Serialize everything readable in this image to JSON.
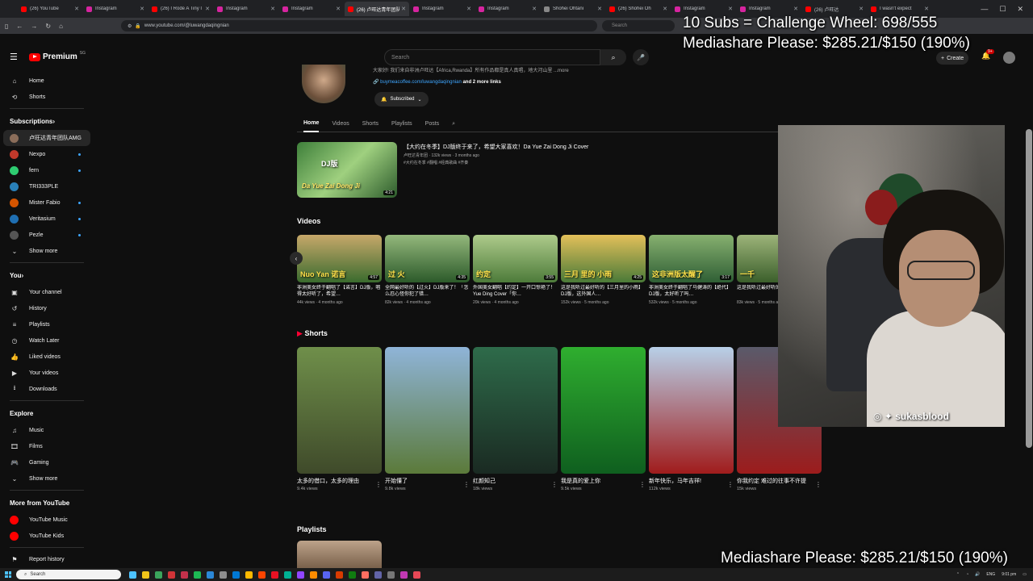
{
  "browser": {
    "tabs": [
      {
        "label": "(26) YouTube",
        "color": "#ff0000",
        "active": false
      },
      {
        "label": "Instagram",
        "color": "#d6249f",
        "active": false
      },
      {
        "label": "(26) I Rode A Tiny I",
        "color": "#ff0000",
        "active": false
      },
      {
        "label": "Instagram",
        "color": "#d6249f",
        "active": false
      },
      {
        "label": "Instagram",
        "color": "#d6249f",
        "active": false
      },
      {
        "label": "(26) 卢旺达青年团队",
        "color": "#ff0000",
        "active": true
      },
      {
        "label": "Instagram",
        "color": "#d6249f",
        "active": false
      },
      {
        "label": "Instagram",
        "color": "#d6249f",
        "active": false
      },
      {
        "label": "Shohei Ohtani",
        "color": "#888888",
        "active": false
      },
      {
        "label": "(26) Shohei Oh",
        "color": "#ff0000",
        "active": false
      },
      {
        "label": "Instagram",
        "color": "#d6249f",
        "active": false
      },
      {
        "label": "Instagram",
        "color": "#d6249f",
        "active": false
      },
      {
        "label": "(26) 卢旺达",
        "color": "#ff0000",
        "active": false
      },
      {
        "label": "I wasn't expect",
        "color": "#ff0000",
        "active": false
      }
    ],
    "url": "www.youtube.com/@luwangdaqingnian",
    "mini_search_placeholder": "Search"
  },
  "youtube": {
    "logo_text": "Premium",
    "logo_country": "SG",
    "search_placeholder": "Search",
    "create_label": "Create",
    "notif_count": "9+"
  },
  "sidebar": {
    "main": [
      {
        "label": "Home",
        "icon": "⌂",
        "name": "home"
      },
      {
        "label": "Shorts",
        "icon": "⟲",
        "name": "shorts"
      }
    ],
    "subscriptions_title": "Subscriptions",
    "subscriptions": [
      {
        "label": "卢旺达青年团队AMG",
        "color": "#8a6d5a",
        "dot": false,
        "active": true
      },
      {
        "label": "Nexpo",
        "color": "#c0392b",
        "dot": true
      },
      {
        "label": "fern",
        "color": "#2ecc71",
        "dot": true
      },
      {
        "label": "TRI333PLE",
        "color": "#2980b9",
        "dot": false
      },
      {
        "label": "Mister Fabio",
        "color": "#d35400",
        "dot": true
      },
      {
        "label": "Veritasium",
        "color": "#1f6fb2",
        "dot": true
      },
      {
        "label": "Pezle",
        "color": "#555555",
        "dot": true
      }
    ],
    "show_more": "Show more",
    "you_title": "You",
    "you": [
      {
        "label": "Your channel",
        "icon": "▣",
        "name": "your-channel"
      },
      {
        "label": "History",
        "icon": "↺",
        "name": "history"
      },
      {
        "label": "Playlists",
        "icon": "≡",
        "name": "playlists"
      },
      {
        "label": "Watch Later",
        "icon": "◷",
        "name": "watch-later"
      },
      {
        "label": "Liked videos",
        "icon": "👍",
        "name": "liked-videos"
      },
      {
        "label": "Your videos",
        "icon": "▶",
        "name": "your-videos"
      },
      {
        "label": "Downloads",
        "icon": "⭳",
        "name": "downloads"
      }
    ],
    "explore_title": "Explore",
    "explore": [
      {
        "label": "Music",
        "icon": "♫",
        "name": "music"
      },
      {
        "label": "Films",
        "icon": "🎞",
        "name": "films"
      },
      {
        "label": "Gaming",
        "icon": "🎮",
        "name": "gaming"
      }
    ],
    "show_more_2": "Show more",
    "more_title": "More from YouTube",
    "more": [
      {
        "label": "YouTube Music",
        "color": "#ff0000",
        "name": "youtube-music"
      },
      {
        "label": "YouTube Kids",
        "color": "#ff0000",
        "name": "youtube-kids"
      }
    ],
    "report": "Report history"
  },
  "channel": {
    "description": "大家好! 我们来自非洲卢旺达【Africa,Rwanda】所有作品都是真人真唱，地大河山里 ...more",
    "link": "buymeacoffee.com/luwangdaqingnian",
    "more_links": "and 2 more links",
    "subscribed": "Subscribed",
    "tabs": [
      "Home",
      "Videos",
      "Shorts",
      "Playlists",
      "Posts"
    ]
  },
  "featured": {
    "title": "【大约在冬季】DJ版终于来了，希望大家喜欢！Da Yue Zai Dong Ji Cover",
    "meta": "卢旺达青年团 · 132k views · 3 months ago",
    "tags": "#大约在冬季 #翻唱 #经典歌曲 #齐秦",
    "thumb_text": "DJ版",
    "thumb_caption": "Da Yue Zai Dong Ji",
    "duration": "4:21"
  },
  "videos_title": "Videos",
  "videos": [
    {
      "title": "非洲美女终于翻唱了【诺言】DJ版，唱得太好听了，希望…",
      "meta": "44k views · 4 months ago",
      "duration": "4:57",
      "thumb_text": "Nuo Yan 诺言",
      "c1": "#3a6b2e",
      "c2": "#c7a86a"
    },
    {
      "title": "全网最好听的【过火】DJ版来了！「怎么忍心怪你犯了错…",
      "meta": "82k views · 4 months ago",
      "duration": "4:35",
      "thumb_text": "过 火",
      "c1": "#2c5a2a",
      "c2": "#94b87c"
    },
    {
      "title": "外国美女翻唱【约定】一开口惊艳了！Yue Ding Cover「你…",
      "meta": "20k views · 4 months ago",
      "duration": "3:55",
      "thumb_text": "约定",
      "c1": "#4d7b3a",
      "c2": "#aecb8b"
    },
    {
      "title": "这是我听过最好听的【三月里的小雨】DJ版，这外国人…",
      "meta": "152k views · 5 months ago",
      "duration": "4:25",
      "thumb_text": "三月 里的 小雨",
      "c1": "#4a7a38",
      "c2": "#e3c05a"
    },
    {
      "title": "非洲美女终于翻唱了马健涛的【绝代】DJ版，太好听了吗…",
      "meta": "532k views · 5 months ago",
      "duration": "3:17",
      "thumb_text": "这非洲版太醒了",
      "c1": "#2f5f35",
      "c2": "#87b06f"
    },
    {
      "title": "这是我听过最好听的…",
      "meta": "83k views · 5 months ago",
      "duration": "",
      "thumb_text": "一千",
      "c1": "#3b5f2b",
      "c2": "#9db47a"
    }
  ],
  "shorts_title": "Shorts",
  "shorts": [
    {
      "title": "太多的借口，太多的理由",
      "views": "9.4k views",
      "c1": "#6f8f4a",
      "c2": "#3f4a2a"
    },
    {
      "title": "开始懂了",
      "views": "9.8k views",
      "c1": "#8fb4d8",
      "c2": "#5b7a3a"
    },
    {
      "title": "红颜知己",
      "views": "18k views",
      "c1": "#2e6b4a",
      "c2": "#1a2a22"
    },
    {
      "title": "我是真的爱上你",
      "views": "9.5k views",
      "c1": "#2fae2f",
      "c2": "#0f5f1f"
    },
    {
      "title": "新年快乐，马年吉祥!",
      "views": "112k views",
      "c1": "#b8d0e8",
      "c2": "#a01c1c"
    },
    {
      "title": "你我约定 难过的往事不许提",
      "views": "15k views",
      "c1": "#5a5a6a",
      "c2": "#9c1c1c"
    }
  ],
  "playlists_title": "Playlists",
  "webcam": {
    "handle": "sukasblood"
  },
  "overlay": {
    "line1": "10 Subs = Challenge Wheel: 698/555",
    "line2": "Mediashare Please: $285.21/$150 (190%)",
    "bottom": "Mediashare Please: $285.21/$150 (190%)"
  },
  "taskbar": {
    "search": "Search",
    "lang": "ENG",
    "time": "9:01 pm"
  }
}
